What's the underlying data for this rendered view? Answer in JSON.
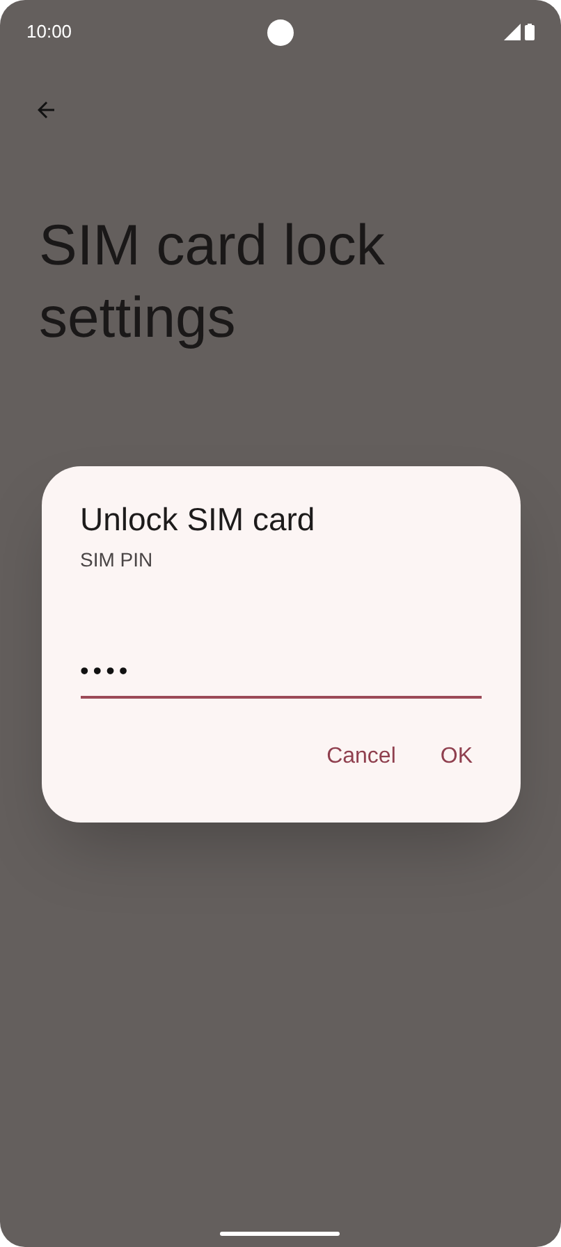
{
  "status_bar": {
    "time": "10:00"
  },
  "page": {
    "title": "SIM card lock settings"
  },
  "dialog": {
    "title": "Unlock SIM card",
    "label": "SIM PIN",
    "value": "••••",
    "buttons": [
      "Cancel",
      "OK"
    ]
  }
}
